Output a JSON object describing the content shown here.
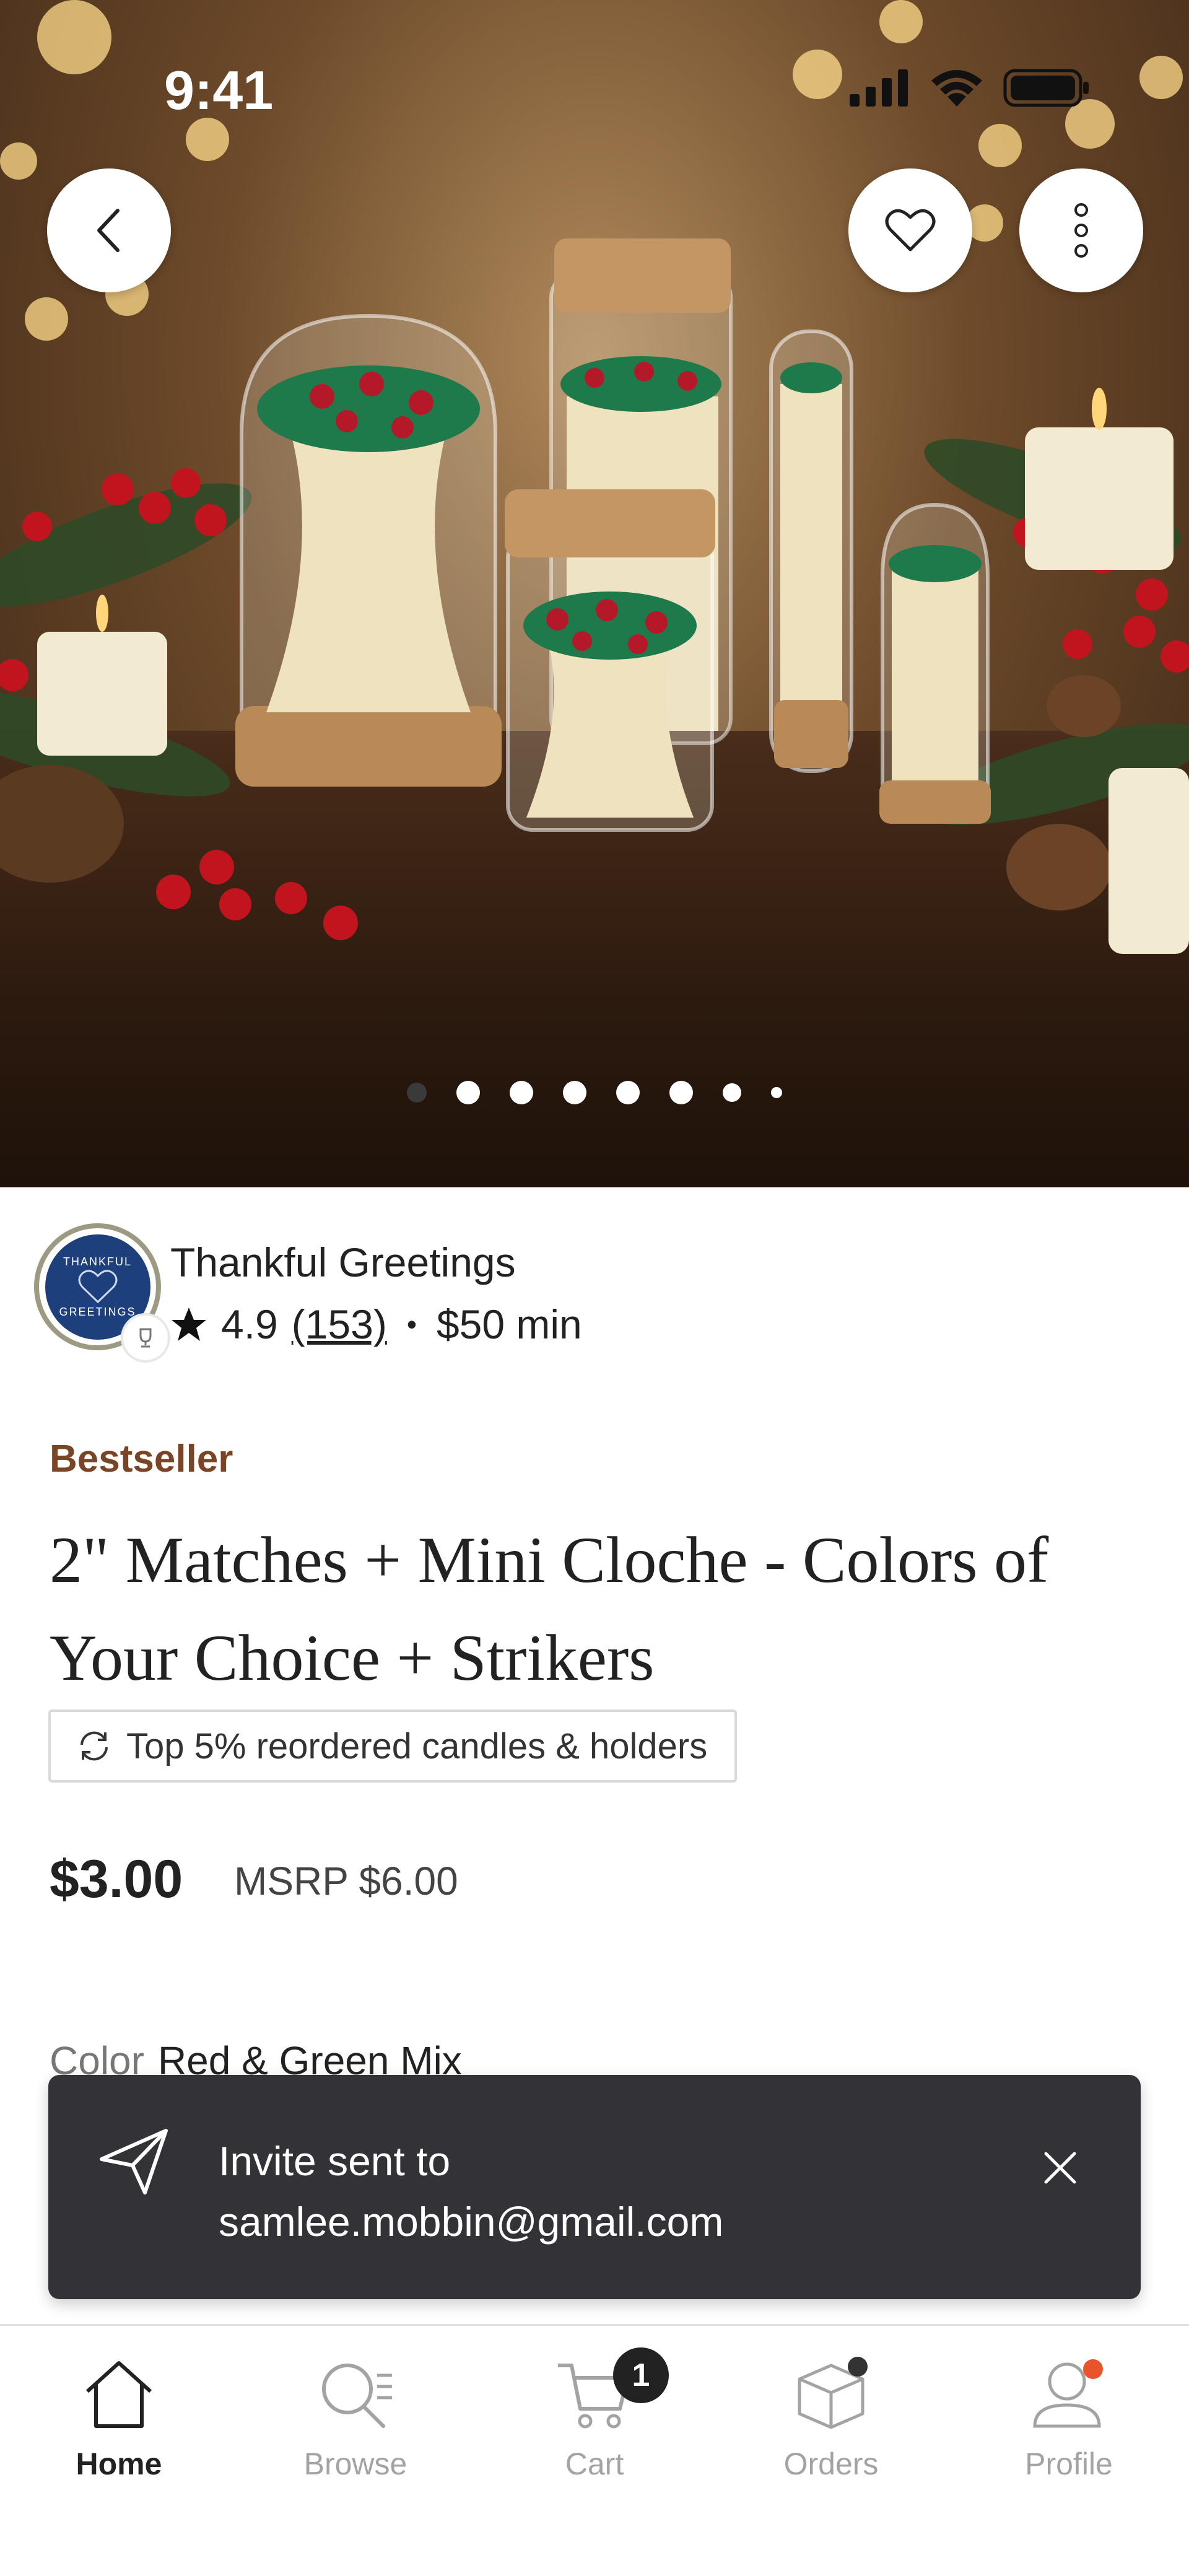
{
  "status_bar": {
    "time": "9:41"
  },
  "hero": {
    "image_count": 8,
    "active_index": 0
  },
  "shop": {
    "name": "Thankful Greetings",
    "avatar_text_top": "THANKFUL",
    "avatar_text_bottom": "GREETINGS",
    "rating": "4.9",
    "review_count": "(153)",
    "separator": "•",
    "minimum": "$50 min"
  },
  "product": {
    "badge": "Bestseller",
    "title": "2\" Matches + Mini Cloche - Colors of Your Choice + Strikers",
    "reorder_badge": "Top 5% reordered candles & holders",
    "price": "$3.00",
    "msrp": "MSRP $6.00",
    "color_label": "Color",
    "color_value": "Red & Green Mix"
  },
  "toast": {
    "line1": "Invite sent to",
    "line2": "samlee.mobbin@gmail.com"
  },
  "tabbar": {
    "tabs": [
      {
        "label": "Home",
        "icon": "home-icon",
        "active": true
      },
      {
        "label": "Browse",
        "icon": "browse-icon",
        "active": false
      },
      {
        "label": "Cart",
        "icon": "cart-icon",
        "active": false,
        "badge": "1"
      },
      {
        "label": "Orders",
        "icon": "orders-icon",
        "active": false
      },
      {
        "label": "Profile",
        "icon": "profile-icon",
        "active": false
      }
    ]
  },
  "colors": {
    "accent_brown": "#7a4526",
    "toast_bg": "#333236",
    "profile_dot": "#e8552d"
  }
}
